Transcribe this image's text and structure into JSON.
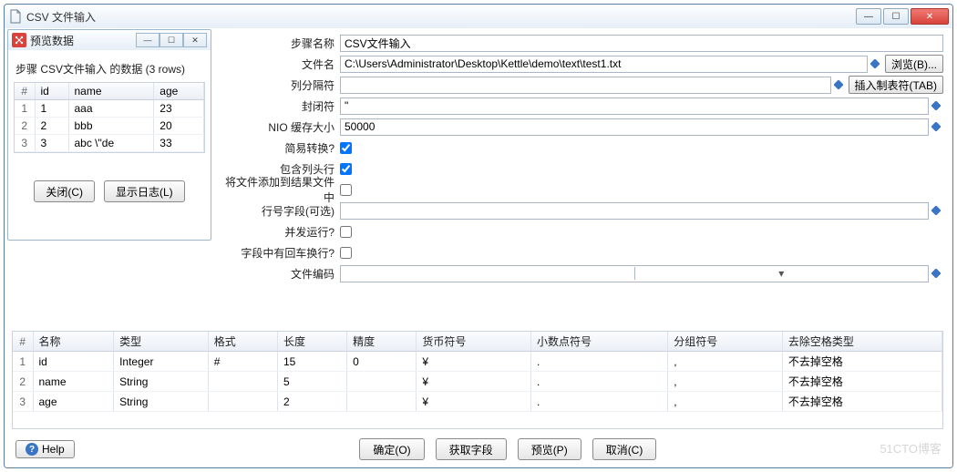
{
  "window": {
    "title": "CSV 文件输入"
  },
  "form": {
    "step_name": {
      "label": "步骤名称",
      "value": "CSV文件输入"
    },
    "filename": {
      "label": "文件名",
      "value": "C:\\Users\\Administrator\\Desktop\\Kettle\\demo\\text\\test1.txt",
      "browse": "浏览(B)..."
    },
    "delimiter": {
      "label": "列分隔符",
      "value": "",
      "insert_tab": "插入制表符(TAB)"
    },
    "enclosure": {
      "label": "封闭符",
      "value": "\""
    },
    "buffer": {
      "label": "NIO 缓存大小",
      "value": "50000"
    },
    "lazy": {
      "label": "简易转换?",
      "checked": true
    },
    "header": {
      "label": "包含列头行",
      "checked": true
    },
    "add_result": {
      "label": "将文件添加到结果文件中",
      "checked": false
    },
    "rownum_field": {
      "label": "行号字段(可选)",
      "value": ""
    },
    "parallel": {
      "label": "并发运行?",
      "checked": false
    },
    "newline": {
      "label": "字段中有回车换行?",
      "checked": false
    },
    "encoding": {
      "label": "文件编码",
      "value": ""
    }
  },
  "fields": {
    "headers": [
      "#",
      "名称",
      "类型",
      "格式",
      "长度",
      "精度",
      "货币符号",
      "小数点符号",
      "分组符号",
      "去除空格类型"
    ],
    "rows": [
      {
        "n": "1",
        "name": "id",
        "type": "Integer",
        "fmt": "#",
        "len": "15",
        "prec": "0",
        "cur": "¥",
        "dec": ".",
        "grp": ",",
        "trim": "不去掉空格"
      },
      {
        "n": "2",
        "name": "name",
        "type": "String",
        "fmt": "",
        "len": "5",
        "prec": "",
        "cur": "¥",
        "dec": ".",
        "grp": ",",
        "trim": "不去掉空格"
      },
      {
        "n": "3",
        "name": "age",
        "type": "String",
        "fmt": "",
        "len": "2",
        "prec": "",
        "cur": "¥",
        "dec": ".",
        "grp": ",",
        "trim": "不去掉空格"
      }
    ]
  },
  "buttons": {
    "help": "Help",
    "ok": "确定(O)",
    "get": "获取字段",
    "preview": "预览(P)",
    "cancel": "取消(C)"
  },
  "preview": {
    "title": "预览数据",
    "caption": "步骤 CSV文件输入 的数据  (3 rows)",
    "headers": [
      "#",
      "id",
      "name",
      "age"
    ],
    "rows": [
      {
        "n": "1",
        "id": "1",
        "name": "aaa",
        "age": "23"
      },
      {
        "n": "2",
        "id": "2",
        "name": "bbb",
        "age": "20"
      },
      {
        "n": "3",
        "id": "3",
        "name": "abc \\\"de",
        "age": "33"
      }
    ],
    "close": "关闭(C)",
    "log": "显示日志(L)"
  },
  "watermark": "51CTO博客"
}
